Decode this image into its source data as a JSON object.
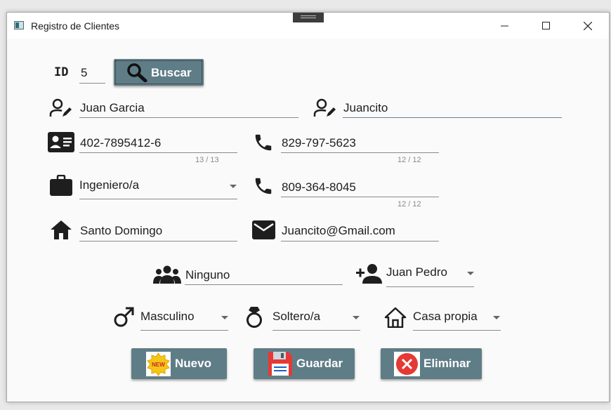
{
  "window": {
    "title": "Registro de Clientes"
  },
  "id_row": {
    "label": "ID",
    "value": "5",
    "search_label": "Buscar"
  },
  "form": {
    "nombre": "Juan Garcia",
    "apodo": "Juancito",
    "cedula": {
      "value": "402-7895412-6",
      "counter": "13 / 13"
    },
    "telefono1": {
      "value": "829-797-5623",
      "counter": "12 / 12"
    },
    "ocupacion": "Ingeniero/a",
    "telefono2": {
      "value": "809-364-8045",
      "counter": "12 / 12"
    },
    "direccion": "Santo Domingo",
    "email": "Juancito@Gmail.com",
    "dependientes": "Ninguno",
    "referido": "Juan Pedro",
    "sexo": "Masculino",
    "estado_civil": "Soltero/a",
    "vivienda": "Casa propia"
  },
  "actions": {
    "nuevo": "Nuevo",
    "guardar": "Guardar",
    "eliminar": "Eliminar"
  },
  "colors": {
    "button_bg": "#5f7d87",
    "icon": "#1e1e1e",
    "danger": "#e53935"
  }
}
